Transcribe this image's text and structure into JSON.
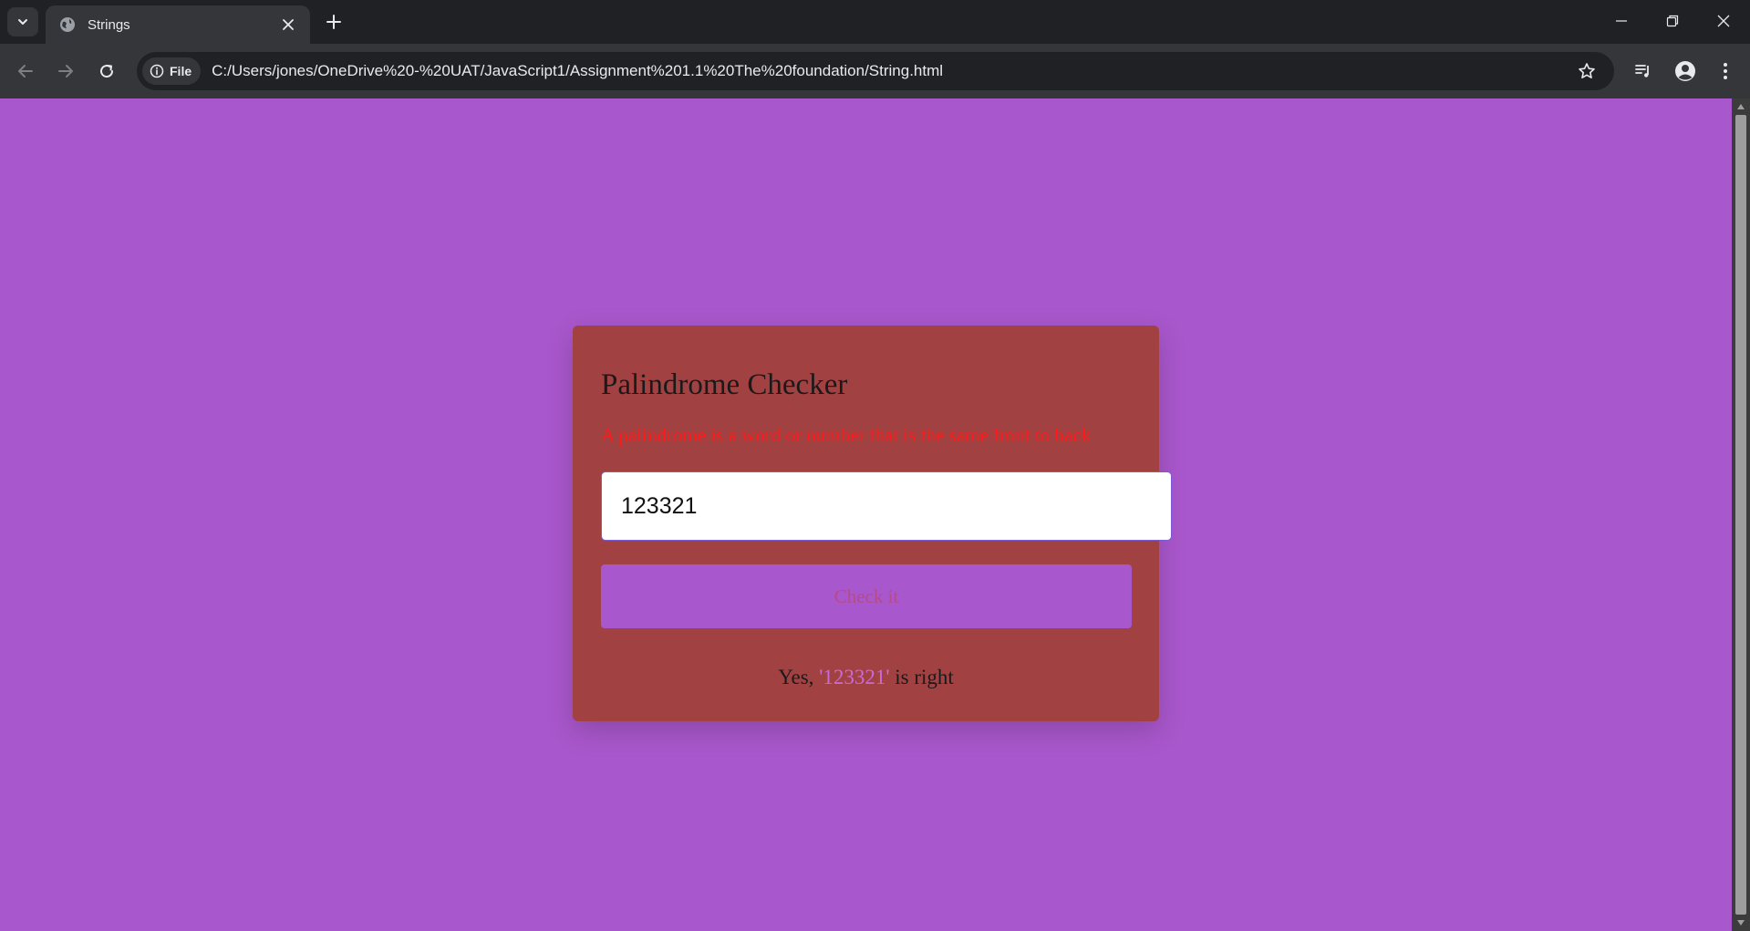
{
  "browser": {
    "tab": {
      "title": "Strings"
    },
    "url": "C:/Users/jones/OneDrive%20-%20UAT/JavaScript1/Assignment%201.1%20The%20foundation/String.html",
    "site_chip_label": "File",
    "colors": {
      "frame": "#202124",
      "toolbar": "#35363a",
      "text": "#e8eaed"
    },
    "icons": {
      "tab_search": "chevron-down-icon",
      "favicon": "globe-icon",
      "tab_close": "close-icon",
      "new_tab": "plus-icon",
      "back": "arrow-left-icon",
      "forward": "arrow-right-icon",
      "reload": "reload-icon",
      "site_info": "info-icon",
      "bookmark": "star-icon",
      "media": "media-queue-icon",
      "profile": "profile-icon",
      "menu": "kebab-menu-icon",
      "minimize": "minimize-icon",
      "restore": "restore-icon",
      "close_window": "close-icon"
    }
  },
  "page": {
    "background": "#a957cc",
    "card": {
      "background": "#a24142",
      "title": "Palindrome Checker",
      "description": "A palindrome is a word or number that is the same front to back",
      "input_value": "123321",
      "button_label": "Check it",
      "result": {
        "prefix": "Yes, ",
        "word": "'123321'",
        "suffix": " is right"
      }
    }
  }
}
